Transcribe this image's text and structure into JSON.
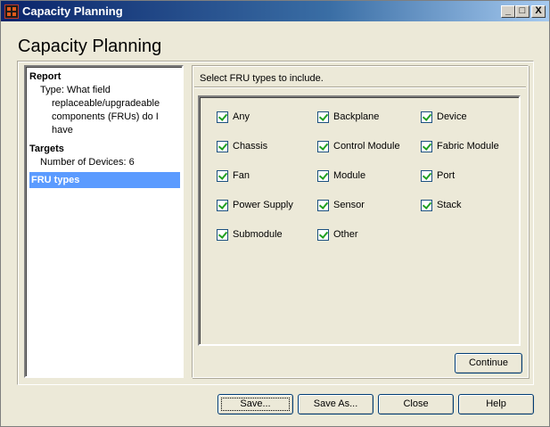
{
  "window": {
    "title": "Capacity Planning",
    "controls": [
      "_",
      "□",
      "X"
    ]
  },
  "page": {
    "heading": "Capacity Planning"
  },
  "nav": {
    "report": {
      "title": "Report",
      "lines": [
        "Type: What field",
        "replaceable/upgradeable",
        "components (FRUs) do I",
        "have"
      ]
    },
    "targets": {
      "title": "Targets",
      "detail": "Number of Devices: 6"
    },
    "selected": "FRU types"
  },
  "content": {
    "prompt": "Select FRU types to include.",
    "fru_types": [
      {
        "label": "Any",
        "checked": true
      },
      {
        "label": "Backplane",
        "checked": true
      },
      {
        "label": "Device",
        "checked": true
      },
      {
        "label": "Chassis",
        "checked": true
      },
      {
        "label": "Control Module",
        "checked": true
      },
      {
        "label": "Fabric Module",
        "checked": true
      },
      {
        "label": "Fan",
        "checked": true
      },
      {
        "label": "Module",
        "checked": true
      },
      {
        "label": "Port",
        "checked": true
      },
      {
        "label": "Power Supply",
        "checked": true
      },
      {
        "label": "Sensor",
        "checked": true
      },
      {
        "label": "Stack",
        "checked": true
      },
      {
        "label": "Submodule",
        "checked": true
      },
      {
        "label": "Other",
        "checked": true
      }
    ],
    "continue_label": "Continue"
  },
  "buttons": {
    "save": "Save...",
    "save_as": "Save As...",
    "close": "Close",
    "help": "Help"
  },
  "colors": {
    "titlebar_start": "#0a246a",
    "selection": "#5b9bff",
    "check": "#21a121"
  }
}
